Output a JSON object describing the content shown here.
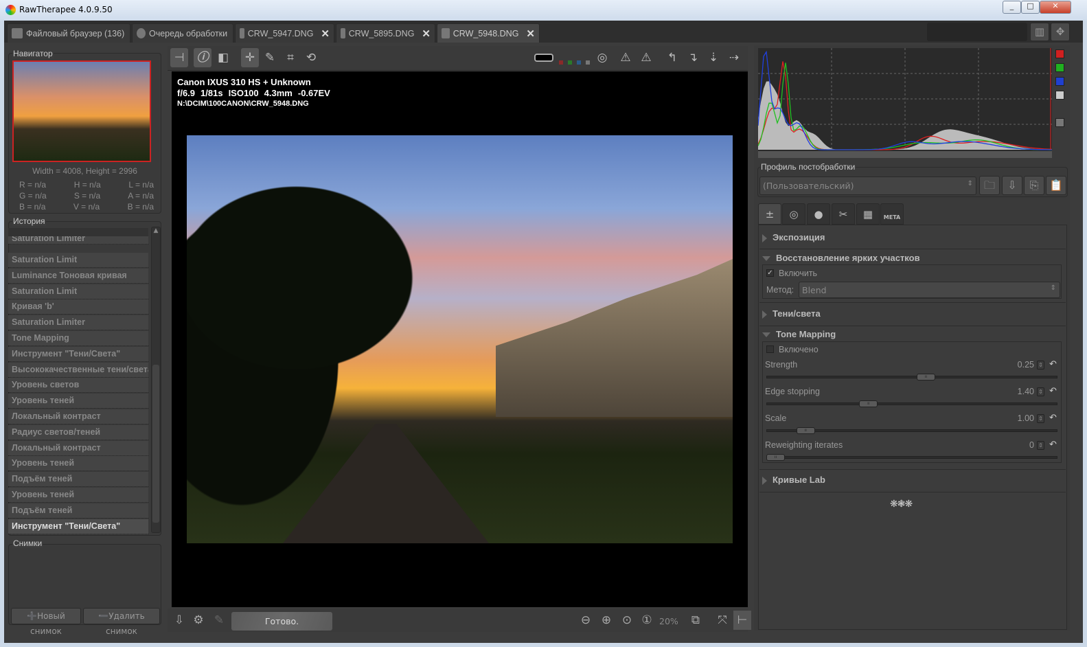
{
  "window": {
    "title": "RawTherapee 4.0.9.50",
    "controls": [
      "_",
      "□",
      "✕"
    ]
  },
  "tabs": [
    {
      "label": "Файловый браузер (136)",
      "icon": "folder-icon"
    },
    {
      "label": "Очередь обработки",
      "icon": "gears-icon"
    },
    {
      "label": "CRW_5947.DNG",
      "icon": "aperture-icon",
      "close": "✕"
    },
    {
      "label": "CRW_5895.DNG",
      "icon": "aperture-icon",
      "close": "✕"
    },
    {
      "label": "CRW_5948.DNG",
      "icon": "aperture-icon",
      "close": "✕",
      "active": true
    }
  ],
  "navigator": {
    "title": "Навигатор",
    "dimensions": "Width = 4008, Height = 2996",
    "values": [
      [
        "R = n/a",
        "H = n/a",
        "L = n/a"
      ],
      [
        "G = n/a",
        "S = n/a",
        "A = n/a"
      ],
      [
        "B = n/a",
        "V = n/a",
        "B = n/a"
      ]
    ]
  },
  "history": {
    "title": "История",
    "items": [
      "Saturation Limiter",
      "Saturation Limit",
      "Luminance Тоновая кривая",
      "Saturation Limit",
      "Кривая 'b'",
      "Saturation Limiter",
      "Tone Mapping",
      "Инструмент \"Тени/Света\"",
      "Высококачественные тени/света",
      "Уровень светов",
      "Уровень теней",
      "Локальный контраст",
      "Радиус светов/теней",
      "Локальный контраст",
      "Уровень теней",
      "Подъём теней",
      "Уровень теней",
      "Подъём теней",
      "Инструмент \"Тени/Света\""
    ],
    "selected_index": 18
  },
  "snapshots": {
    "title": "Снимки",
    "new_label": "Новый снимок",
    "delete_label": "Удалить снимок"
  },
  "exif": {
    "camera": "Canon IXUS 310 HS + Unknown",
    "aperture": "f/6.9",
    "shutter": "1/81s",
    "iso": "ISO100",
    "focal": "4.3mm",
    "ev": "-0.67EV",
    "path": "N:\\DCIM\\100CANON\\CRW_5948.DNG"
  },
  "statusbar": {
    "status": "Готово.",
    "zoom": "20%"
  },
  "profile": {
    "title": "Профиль постобработки",
    "value": "(Пользовательский)"
  },
  "tool_tabs": [
    "exposure-icon",
    "detail-icon",
    "color-icon",
    "transform-icon",
    "raw-icon",
    "META"
  ],
  "panels": {
    "exposure": "Экспозиция",
    "highlight": {
      "title": "Восстановление ярких участков",
      "enable_label": "Включить",
      "enabled": true,
      "method_label": "Метод:",
      "method": "Blend"
    },
    "shadows": "Тени/света",
    "tonemap": {
      "title": "Tone Mapping",
      "enable_label": "Включено",
      "enabled": false,
      "sliders": [
        {
          "label": "Strength",
          "value": "0.25",
          "fraction": 0.55
        },
        {
          "label": "Edge stopping",
          "value": "1.40",
          "fraction": 0.34
        },
        {
          "label": "Scale",
          "value": "1.00",
          "fraction": 0.11
        },
        {
          "label": "Reweighting iterates",
          "value": "0",
          "fraction": 0.0
        }
      ]
    },
    "lab": "Кривые Lab"
  },
  "histogram": {
    "channel_colors": [
      "#e02020",
      "#20c020",
      "#2040e0",
      "#cccccc"
    ]
  }
}
